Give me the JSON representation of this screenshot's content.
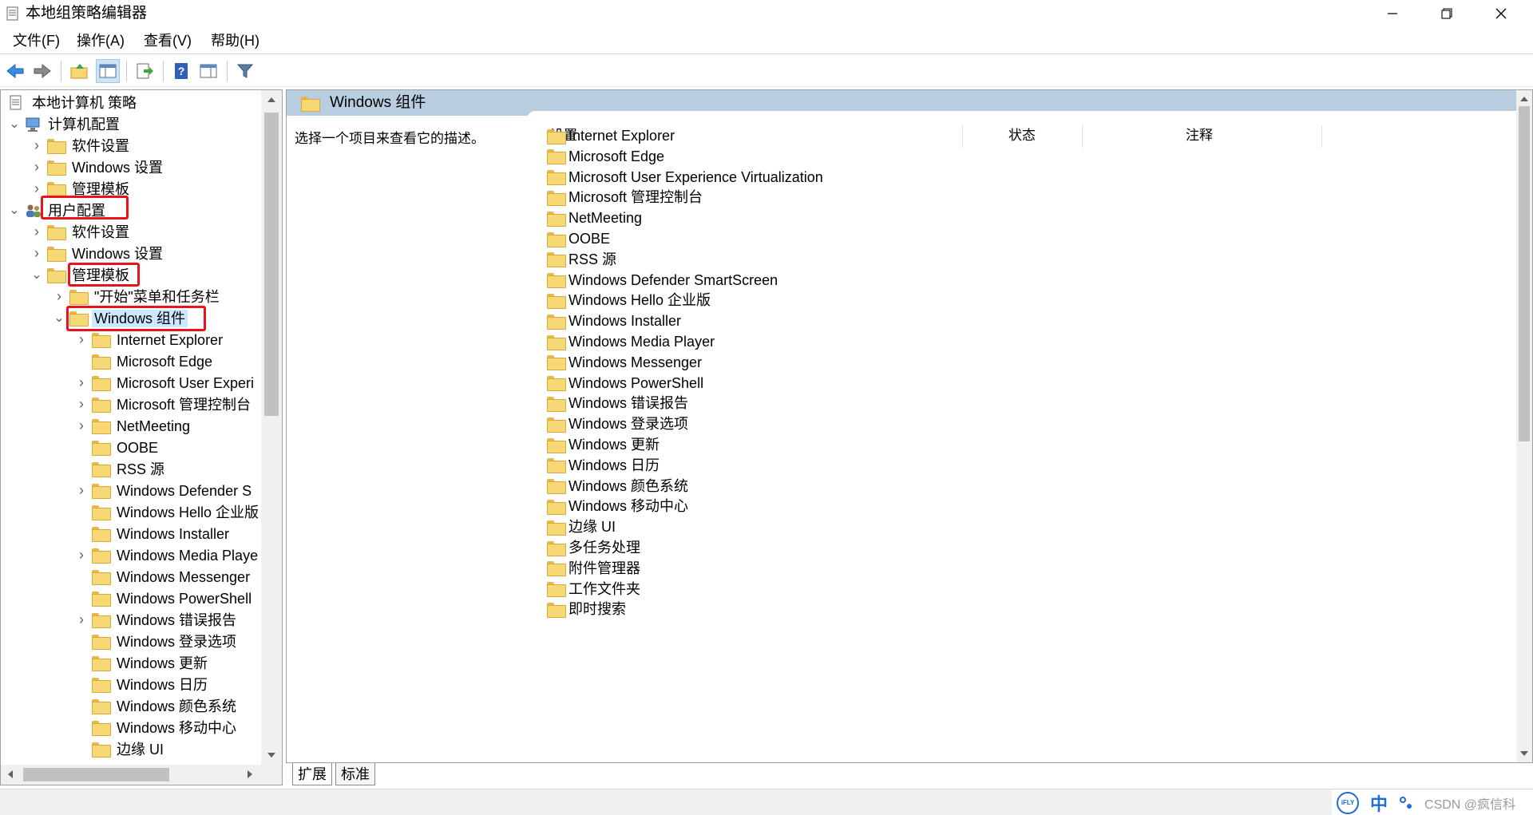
{
  "window": {
    "title": "本地组策略编辑器"
  },
  "menu": [
    {
      "label": "文件(F)"
    },
    {
      "label": "操作(A)"
    },
    {
      "label": "查看(V)"
    },
    {
      "label": "帮助(H)"
    }
  ],
  "tree": {
    "nodes": [
      {
        "label": "本地计算机 策略",
        "icon": "policy-doc-icon",
        "arrow": ""
      },
      {
        "label": "计算机配置",
        "icon": "computer-icon",
        "arrow": "expanded"
      },
      {
        "label": "软件设置",
        "icon": "folder-icon",
        "arrow": "collapsed"
      },
      {
        "label": "Windows 设置",
        "icon": "folder-icon",
        "arrow": "collapsed"
      },
      {
        "label": "管理模板",
        "icon": "folder-icon",
        "arrow": "collapsed"
      },
      {
        "label": "用户配置",
        "icon": "users-icon",
        "arrow": "expanded"
      },
      {
        "label": "软件设置",
        "icon": "folder-icon",
        "arrow": "collapsed"
      },
      {
        "label": "Windows 设置",
        "icon": "folder-icon",
        "arrow": "collapsed"
      },
      {
        "label": "管理模板",
        "icon": "folder-icon",
        "arrow": "expanded"
      },
      {
        "label": "\"开始\"菜单和任务栏",
        "icon": "folder-icon",
        "arrow": "collapsed"
      },
      {
        "label": "Windows 组件",
        "icon": "folder-icon",
        "arrow": "expanded",
        "selected": true
      },
      {
        "label": "Internet Explorer",
        "icon": "folder-icon",
        "arrow": "collapsed"
      },
      {
        "label": "Microsoft Edge",
        "icon": "folder-icon",
        "arrow": ""
      },
      {
        "label": "Microsoft User Experi",
        "icon": "folder-icon",
        "arrow": "collapsed"
      },
      {
        "label": "Microsoft 管理控制台",
        "icon": "folder-icon",
        "arrow": "collapsed"
      },
      {
        "label": "NetMeeting",
        "icon": "folder-icon",
        "arrow": "collapsed"
      },
      {
        "label": "OOBE",
        "icon": "folder-icon",
        "arrow": ""
      },
      {
        "label": "RSS 源",
        "icon": "folder-icon",
        "arrow": ""
      },
      {
        "label": "Windows Defender S",
        "icon": "folder-icon",
        "arrow": "collapsed"
      },
      {
        "label": "Windows Hello 企业版",
        "icon": "folder-icon",
        "arrow": ""
      },
      {
        "label": "Windows Installer",
        "icon": "folder-icon",
        "arrow": ""
      },
      {
        "label": "Windows Media Playe",
        "icon": "folder-icon",
        "arrow": "collapsed"
      },
      {
        "label": "Windows Messenger",
        "icon": "folder-icon",
        "arrow": ""
      },
      {
        "label": "Windows PowerShell",
        "icon": "folder-icon",
        "arrow": ""
      },
      {
        "label": "Windows 错误报告",
        "icon": "folder-icon",
        "arrow": "collapsed"
      },
      {
        "label": "Windows 登录选项",
        "icon": "folder-icon",
        "arrow": ""
      },
      {
        "label": "Windows 更新",
        "icon": "folder-icon",
        "arrow": ""
      },
      {
        "label": "Windows 日历",
        "icon": "folder-icon",
        "arrow": ""
      },
      {
        "label": "Windows 颜色系统",
        "icon": "folder-icon",
        "arrow": ""
      },
      {
        "label": "Windows 移动中心",
        "icon": "folder-icon",
        "arrow": ""
      },
      {
        "label": "边缘 UI",
        "icon": "folder-icon",
        "arrow": ""
      }
    ]
  },
  "right": {
    "header_title": "Windows 组件",
    "description": "选择一个项目来查看它的描述。",
    "columns": [
      "设置",
      "状态",
      "注释"
    ],
    "items": [
      "Internet Explorer",
      "Microsoft Edge",
      "Microsoft User Experience Virtualization",
      "Microsoft 管理控制台",
      "NetMeeting",
      "OOBE",
      "RSS 源",
      "Windows Defender SmartScreen",
      "Windows Hello 企业版",
      "Windows Installer",
      "Windows Media Player",
      "Windows Messenger",
      "Windows PowerShell",
      "Windows 错误报告",
      "Windows 登录选项",
      "Windows 更新",
      "Windows 日历",
      "Windows 颜色系统",
      "Windows 移动中心",
      "边缘 UI",
      "多任务处理",
      "附件管理器",
      "工作文件夹",
      "即时搜索"
    ]
  },
  "tabs": [
    {
      "label": "扩展"
    },
    {
      "label": "标准",
      "active": true
    }
  ],
  "ime": {
    "mode": "中",
    "brand": "iFLY",
    "watermark": "CSDN @疯信科"
  },
  "colors": {
    "highlight_box": "#e8131b",
    "header_bg": "#b8cde0",
    "selected_bg": "#cce8ff",
    "folder": "#f8d775"
  }
}
